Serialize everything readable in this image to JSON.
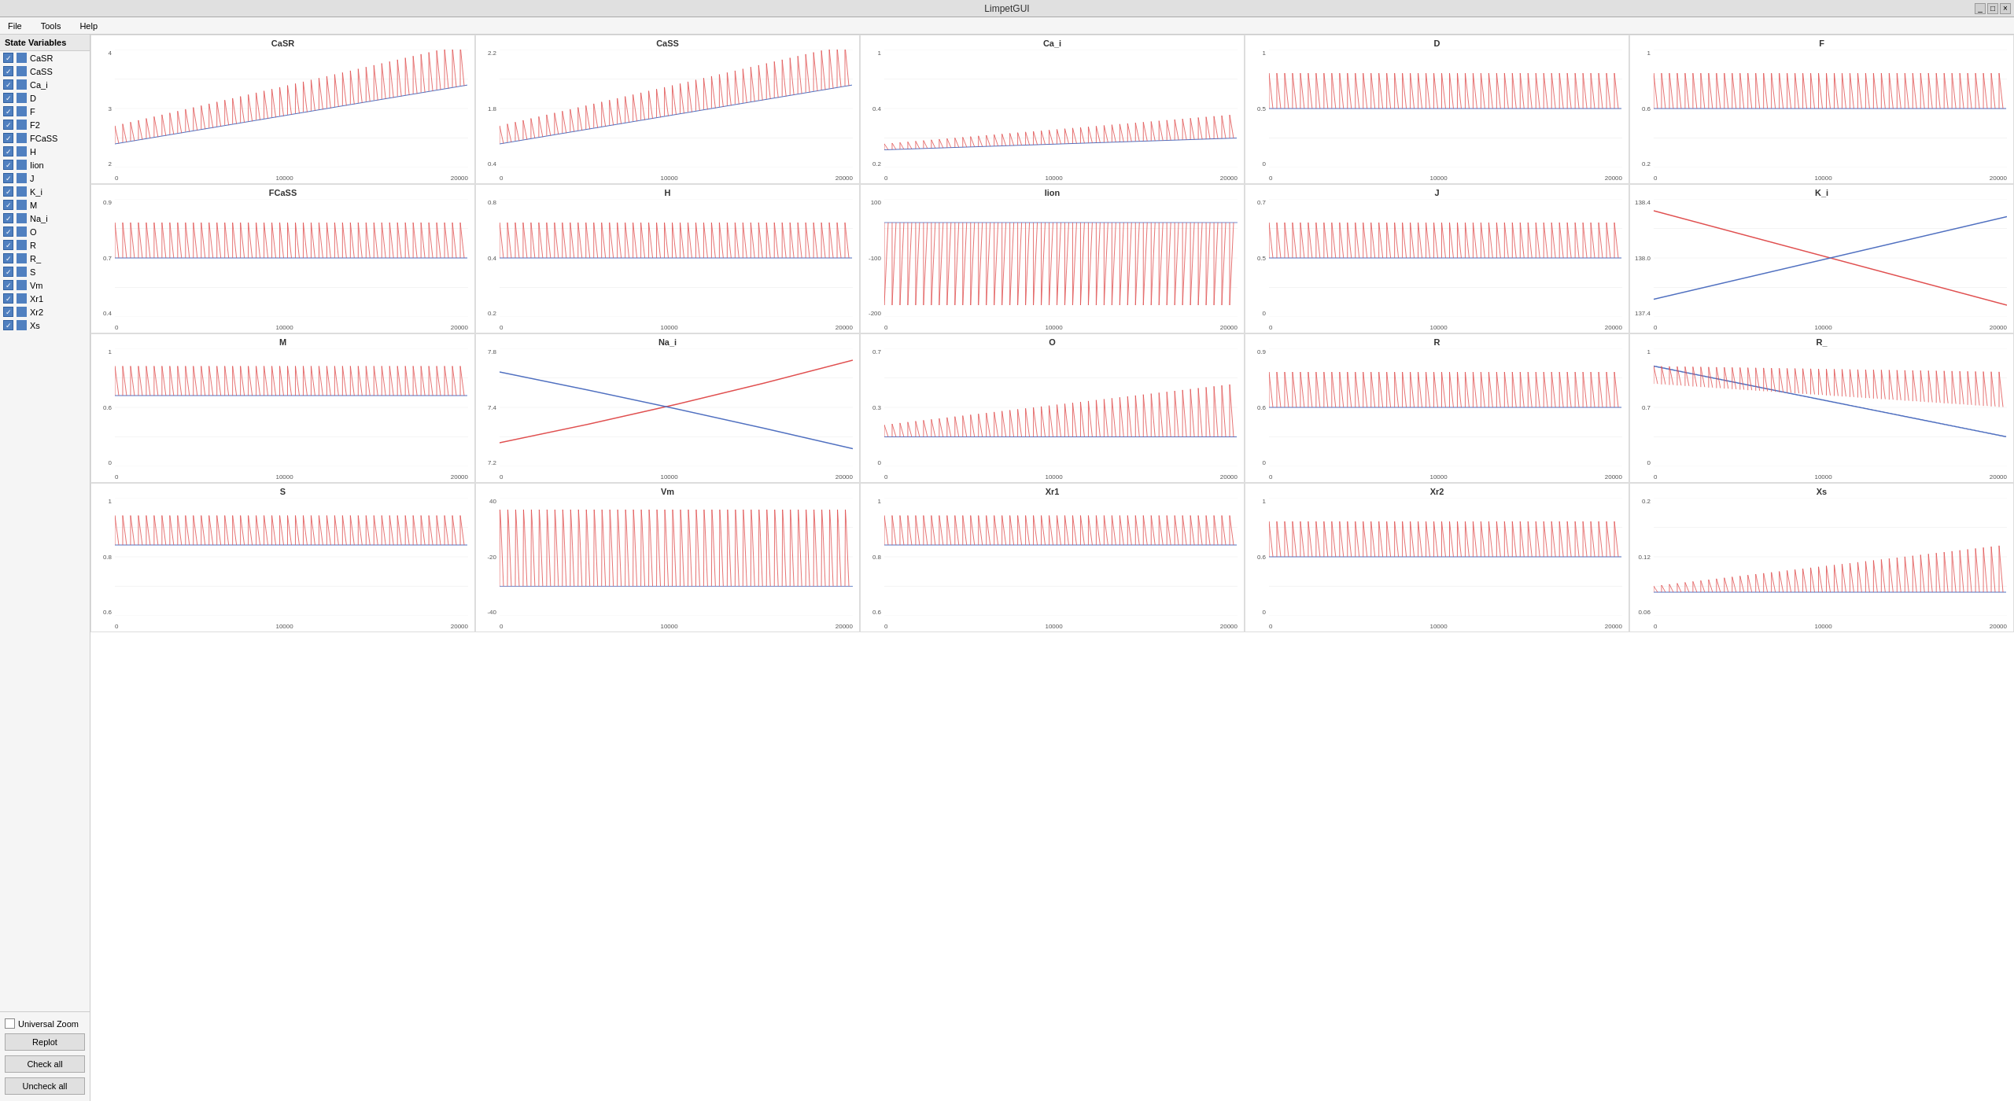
{
  "app": {
    "title": "LimpetGUI"
  },
  "titlebar": {
    "controls": [
      "_",
      "□",
      "×"
    ]
  },
  "menu": {
    "items": [
      "File",
      "Tools",
      "Help"
    ]
  },
  "sidebar": {
    "header": "State Variables",
    "items": [
      {
        "name": "CaSR",
        "checked": true,
        "color": "#5080c0"
      },
      {
        "name": "CaSS",
        "checked": true,
        "color": "#5080c0"
      },
      {
        "name": "Ca_i",
        "checked": true,
        "color": "#5080c0"
      },
      {
        "name": "D",
        "checked": true,
        "color": "#5080c0"
      },
      {
        "name": "F",
        "checked": true,
        "color": "#5080c0"
      },
      {
        "name": "F2",
        "checked": true,
        "color": "#5080c0"
      },
      {
        "name": "FCaSS",
        "checked": true,
        "color": "#5080c0"
      },
      {
        "name": "H",
        "checked": true,
        "color": "#5080c0"
      },
      {
        "name": "Iion",
        "checked": true,
        "color": "#5080c0"
      },
      {
        "name": "J",
        "checked": true,
        "color": "#5080c0"
      },
      {
        "name": "K_i",
        "checked": true,
        "color": "#5080c0"
      },
      {
        "name": "M",
        "checked": true,
        "color": "#5080c0"
      },
      {
        "name": "Na_i",
        "checked": true,
        "color": "#5080c0"
      },
      {
        "name": "O",
        "checked": true,
        "color": "#5080c0"
      },
      {
        "name": "R",
        "checked": true,
        "color": "#5080c0"
      },
      {
        "name": "R_",
        "checked": true,
        "color": "#5080c0"
      },
      {
        "name": "S",
        "checked": true,
        "color": "#5080c0"
      },
      {
        "name": "Vm",
        "checked": true,
        "color": "#5080c0"
      },
      {
        "name": "Xr1",
        "checked": true,
        "color": "#5080c0"
      },
      {
        "name": "Xr2",
        "checked": true,
        "color": "#5080c0"
      },
      {
        "name": "Xs",
        "checked": true,
        "color": "#5080c0"
      }
    ],
    "universal_zoom_label": "Universal Zoom",
    "replot_label": "Replot",
    "check_all_label": "Check all",
    "uncheck_all_label": "Uncheck all"
  },
  "charts": [
    {
      "title": "CaSR",
      "y_max": "4",
      "y_mid": "3",
      "y_min": "2",
      "x_vals": [
        "0",
        "10000",
        "20000"
      ],
      "type": "oscillating_rise"
    },
    {
      "title": "CaSS",
      "y_max": "2.2",
      "y_mid": "1.8",
      "y_min": "0.4",
      "x_vals": [
        "0",
        "10000",
        "20000"
      ],
      "type": "oscillating_rise"
    },
    {
      "title": "Ca_i",
      "y_max": "1",
      "y_mid": "0.4",
      "y_min": "0.2",
      "x_vals": [
        "0",
        "10000",
        "20000"
      ],
      "type": "oscillating_rise_small"
    },
    {
      "title": "D",
      "y_max": "1",
      "y_mid": "0.5",
      "y_min": "0",
      "x_vals": [
        "0",
        "10000",
        "20000"
      ],
      "type": "oscillating_flat"
    },
    {
      "title": "F",
      "y_max": "1",
      "y_mid": "0.6",
      "y_min": "0.2",
      "x_vals": [
        "0",
        "10000",
        "20000"
      ],
      "type": "oscillating_flat"
    },
    {
      "title": "FCaSS",
      "y_max": "0.9",
      "y_mid": "0.7",
      "y_min": "0.4",
      "x_vals": [
        "0",
        "10000",
        "20000"
      ],
      "type": "oscillating_flat"
    },
    {
      "title": "H",
      "y_max": "0.8",
      "y_mid": "0.4",
      "y_min": "0.2",
      "x_vals": [
        "0",
        "10000",
        "20000"
      ],
      "type": "oscillating_flat"
    },
    {
      "title": "Iion",
      "y_max": "100",
      "y_mid": "-100",
      "y_min": "-200",
      "x_vals": [
        "0",
        "10000",
        "20000"
      ],
      "type": "oscillating_bipolar"
    },
    {
      "title": "J",
      "y_max": "0.7",
      "y_mid": "0.5",
      "y_min": "0",
      "x_vals": [
        "0",
        "10000",
        "20000"
      ],
      "type": "oscillating_flat"
    },
    {
      "title": "K_i",
      "y_max": "138.4",
      "y_mid": "138.0",
      "y_min": "137.4",
      "x_vals": [
        "0",
        "10000",
        "20000"
      ],
      "type": "declining_cross"
    },
    {
      "title": "M",
      "y_max": "1",
      "y_mid": "0.6",
      "y_min": "0",
      "x_vals": [
        "0",
        "10000",
        "20000"
      ],
      "type": "oscillating_flat_dense"
    },
    {
      "title": "Na_i",
      "y_max": "7.8",
      "y_mid": "7.4",
      "y_min": "7.2",
      "x_vals": [
        "0",
        "10000",
        "20000"
      ],
      "type": "cross_curves"
    },
    {
      "title": "O",
      "y_max": "0.7",
      "y_mid": "0.3",
      "y_min": "0",
      "x_vals": [
        "0",
        "10000",
        "20000"
      ],
      "type": "oscillating_rise_mid"
    },
    {
      "title": "R",
      "y_max": "0.9",
      "y_mid": "0.6",
      "y_min": "0",
      "x_vals": [
        "0",
        "10000",
        "20000"
      ],
      "type": "oscillating_flat"
    },
    {
      "title": "R_",
      "y_max": "1",
      "y_mid": "0.7",
      "y_min": "0",
      "x_vals": [
        "0",
        "10000",
        "20000"
      ],
      "type": "oscillating_rise_cross"
    },
    {
      "title": "S",
      "y_max": "1",
      "y_mid": "0.8",
      "y_min": "0.6",
      "x_vals": [
        "0",
        "10000",
        "20000"
      ],
      "type": "oscillating_flat_dense"
    },
    {
      "title": "Vm",
      "y_max": "40",
      "y_mid": "-20",
      "y_min": "-40",
      "x_vals": [
        "0",
        "10000",
        "20000"
      ],
      "type": "oscillating_bipolar_vm"
    },
    {
      "title": "Xr1",
      "y_max": "1",
      "y_mid": "0.8",
      "y_min": "0.6",
      "x_vals": [
        "0",
        "10000",
        "20000"
      ],
      "type": "oscillating_flat_dense"
    },
    {
      "title": "Xr2",
      "y_max": "1",
      "y_mid": "0.6",
      "y_min": "0",
      "x_vals": [
        "0",
        "10000",
        "20000"
      ],
      "type": "oscillating_flat"
    },
    {
      "title": "Xs",
      "y_max": "0.2",
      "y_mid": "0.12",
      "y_min": "0.06",
      "x_vals": [
        "0",
        "10000",
        "20000"
      ],
      "type": "oscillating_rise_small2"
    }
  ]
}
